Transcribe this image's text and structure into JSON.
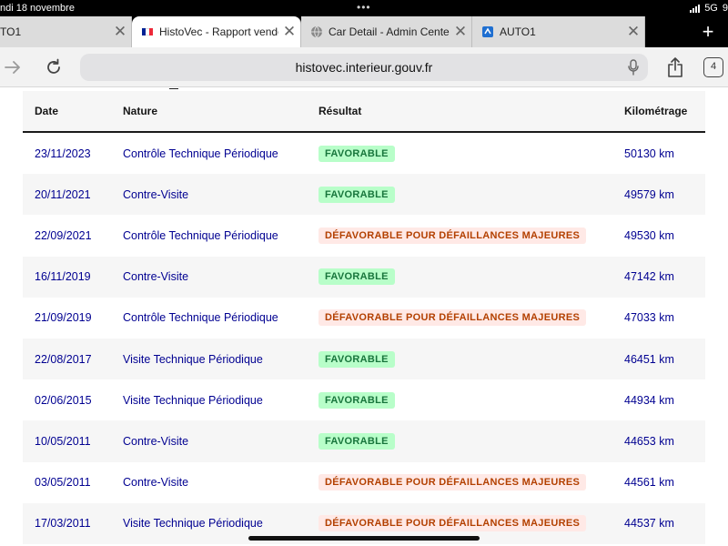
{
  "status_bar": {
    "datetime": "ndi 18 novembre",
    "network": "5G",
    "battery": "9"
  },
  "tabs": [
    {
      "title": "TO1",
      "active": false
    },
    {
      "title": "HistoVec - Rapport vendeur",
      "active": true
    },
    {
      "title": "Car Detail - Admin Center",
      "active": false
    },
    {
      "title": "AUTO1",
      "active": false
    }
  ],
  "address_bar": {
    "url": "histovec.interieur.gouv.fr",
    "tab_count": "4"
  },
  "table": {
    "headers": {
      "date": "Date",
      "nature": "Nature",
      "result": "Résultat",
      "mileage": "Kilométrage"
    },
    "rows": [
      {
        "date": "23/11/2023",
        "nature": "Contrôle Technique Périodique",
        "result": "FAVORABLE",
        "status": "ok",
        "mileage": "50130 km"
      },
      {
        "date": "20/11/2021",
        "nature": "Contre-Visite",
        "result": "FAVORABLE",
        "status": "ok",
        "mileage": "49579 km"
      },
      {
        "date": "22/09/2021",
        "nature": "Contrôle Technique Périodique",
        "result": "DÉFAVORABLE POUR DÉFAILLANCES MAJEURES",
        "status": "ko",
        "mileage": "49530 km"
      },
      {
        "date": "16/11/2019",
        "nature": "Contre-Visite",
        "result": "FAVORABLE",
        "status": "ok",
        "mileage": "47142 km"
      },
      {
        "date": "21/09/2019",
        "nature": "Contrôle Technique Périodique",
        "result": "DÉFAVORABLE POUR DÉFAILLANCES MAJEURES",
        "status": "ko",
        "mileage": "47033 km"
      },
      {
        "date": "22/08/2017",
        "nature": "Visite Technique Périodique",
        "result": "FAVORABLE",
        "status": "ok",
        "mileage": "46451 km"
      },
      {
        "date": "02/06/2015",
        "nature": "Visite Technique Périodique",
        "result": "FAVORABLE",
        "status": "ok",
        "mileage": "44934 km"
      },
      {
        "date": "10/05/2011",
        "nature": "Contre-Visite",
        "result": "FAVORABLE",
        "status": "ok",
        "mileage": "44653 km"
      },
      {
        "date": "03/05/2011",
        "nature": "Contre-Visite",
        "result": "DÉFAVORABLE POUR DÉFAILLANCES MAJEURES",
        "status": "ko",
        "mileage": "44561 km"
      },
      {
        "date": "17/03/2011",
        "nature": "Visite Technique Périodique",
        "result": "DÉFAVORABLE POUR DÉFAILLANCES MAJEURES",
        "status": "ko",
        "mileage": "44537 km"
      }
    ]
  },
  "colors": {
    "link_blue": "#000091",
    "favorable_bg": "#b8fec9",
    "favorable_text": "#18753c",
    "defavorable_bg": "#ffe9e6",
    "defavorable_text": "#b34000"
  },
  "icons": [
    "signal-icon",
    "battery-icon",
    "close-icon",
    "flag-icon",
    "globe-icon",
    "auto1-icon",
    "plus-icon",
    "forward-icon",
    "reload-icon",
    "microphone-icon",
    "share-icon",
    "tabs-icon"
  ]
}
